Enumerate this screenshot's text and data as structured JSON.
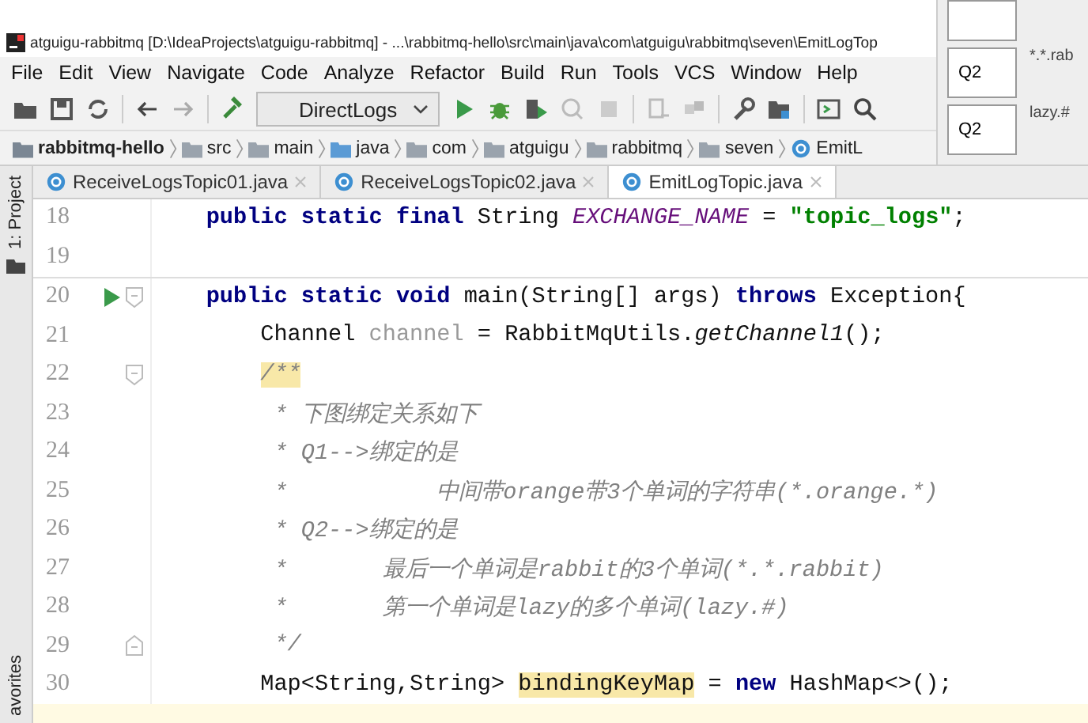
{
  "window": {
    "title": "atguigu-rabbitmq [D:\\IdeaProjects\\atguigu-rabbitmq] - ...\\rabbitmq-hello\\src\\main\\java\\com\\atguigu\\rabbitmq\\seven\\EmitLogTop"
  },
  "menu": [
    "File",
    "Edit",
    "View",
    "Navigate",
    "Code",
    "Analyze",
    "Refactor",
    "Build",
    "Run",
    "Tools",
    "VCS",
    "Window",
    "Help"
  ],
  "toolbar": {
    "run_config": "DirectLogs"
  },
  "breadcrumb": [
    {
      "label": "rabbitmq-hello",
      "kind": "module"
    },
    {
      "label": "src",
      "kind": "folder"
    },
    {
      "label": "main",
      "kind": "folder"
    },
    {
      "label": "java",
      "kind": "source"
    },
    {
      "label": "com",
      "kind": "package"
    },
    {
      "label": "atguigu",
      "kind": "package"
    },
    {
      "label": "rabbitmq",
      "kind": "package"
    },
    {
      "label": "seven",
      "kind": "package"
    },
    {
      "label": "EmitL",
      "kind": "class"
    }
  ],
  "side_tabs": {
    "top": "1: Project",
    "bottom": "avorites"
  },
  "tabs": [
    {
      "label": "ReceiveLogsTopic01.java",
      "selected": false
    },
    {
      "label": "ReceiveLogsTopic02.java",
      "selected": false
    },
    {
      "label": "EmitLogTopic.java",
      "selected": true
    }
  ],
  "lines": [
    {
      "number": "18",
      "tokens": [
        {
          "text": "    public static final ",
          "kind": "kw"
        },
        {
          "text": "String ",
          "kind": "plain"
        },
        {
          "text": "EXCHANGE_NAME",
          "kind": "const"
        },
        {
          "text": " = ",
          "kind": "plain"
        },
        {
          "text": "\"topic_logs\"",
          "kind": "str"
        },
        {
          "text": ";",
          "kind": "plain"
        }
      ]
    },
    {
      "number": "19"
    },
    {
      "number": "20",
      "run": true,
      "fold_start": true,
      "tokens": [
        {
          "text": "    public static void ",
          "kind": "kw"
        },
        {
          "text": "main(String[] args) ",
          "kind": "plain"
        },
        {
          "text": "throws ",
          "kind": "kw"
        },
        {
          "text": "Exception{",
          "kind": "plain"
        }
      ]
    },
    {
      "number": "21",
      "tokens": [
        {
          "text": "        Channel ",
          "kind": "plain"
        },
        {
          "text": "channel",
          "kind": "unused"
        },
        {
          "text": " = RabbitMqUtils.",
          "kind": "plain"
        },
        {
          "text": "getChannel1",
          "kind": "static"
        },
        {
          "text": "();",
          "kind": "plain"
        }
      ]
    },
    {
      "number": "22",
      "fold_start": true,
      "tokens": [
        {
          "text": "        /**",
          "kind": "comment-hl"
        }
      ]
    },
    {
      "number": "23",
      "tokens": [
        {
          "text": "         * 下图绑定关系如下",
          "kind": "comment"
        }
      ]
    },
    {
      "number": "24",
      "tokens": [
        {
          "text": "         * Q1-->绑定的是",
          "kind": "comment"
        }
      ]
    },
    {
      "number": "25",
      "tokens": [
        {
          "text": "         *           中间带orange带3个单词的字符串(*.orange.*)",
          "kind": "comment"
        }
      ]
    },
    {
      "number": "26",
      "tokens": [
        {
          "text": "         * Q2-->绑定的是",
          "kind": "comment"
        }
      ]
    },
    {
      "number": "27",
      "tokens": [
        {
          "text": "         *       最后一个单词是rabbit的3个单词(*.*.rabbit)",
          "kind": "comment"
        }
      ]
    },
    {
      "number": "28",
      "tokens": [
        {
          "text": "         *       第一个单词是lazy的多个单词(lazy.#)",
          "kind": "comment"
        }
      ]
    },
    {
      "number": "29",
      "fold_end": true,
      "tokens": [
        {
          "text": "         */",
          "kind": "comment"
        }
      ]
    },
    {
      "number": "30",
      "tokens": [
        {
          "text": "        Map<String,String> ",
          "kind": "plain"
        },
        {
          "text": "bindingKeyMap",
          "kind": "hl"
        },
        {
          "text": " = ",
          "kind": "plain"
        },
        {
          "text": "new ",
          "kind": "kw"
        },
        {
          "text": "HashMap<>();",
          "kind": "plain"
        }
      ]
    }
  ],
  "overlay_table": {
    "rows": [
      {
        "queue": "Q2",
        "key": "*.*.rab"
      },
      {
        "queue": "Q2",
        "key": "lazy.#"
      }
    ]
  }
}
